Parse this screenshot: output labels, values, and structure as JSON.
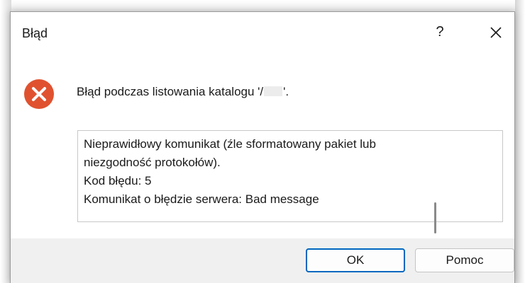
{
  "dialog": {
    "title": "Błąd",
    "help_glyph": "?",
    "close_icon": "close-icon",
    "error_icon": "error-circle-x-icon",
    "error_icon_color": "#e0522f",
    "message_prefix": "Błąd podczas listowania katalogu '/",
    "message_suffix": "'.",
    "details_lines": [
      "Nieprawidłowy komunikat (źle sformatowany pakiet lub",
      "niezgodność protokołów).",
      "Kod błędu: 5",
      "Komunikat o błędzie serwera: Bad message"
    ],
    "buttons": {
      "ok": "OK",
      "help": "Pomoc"
    },
    "accent_color": "#0067c0"
  }
}
